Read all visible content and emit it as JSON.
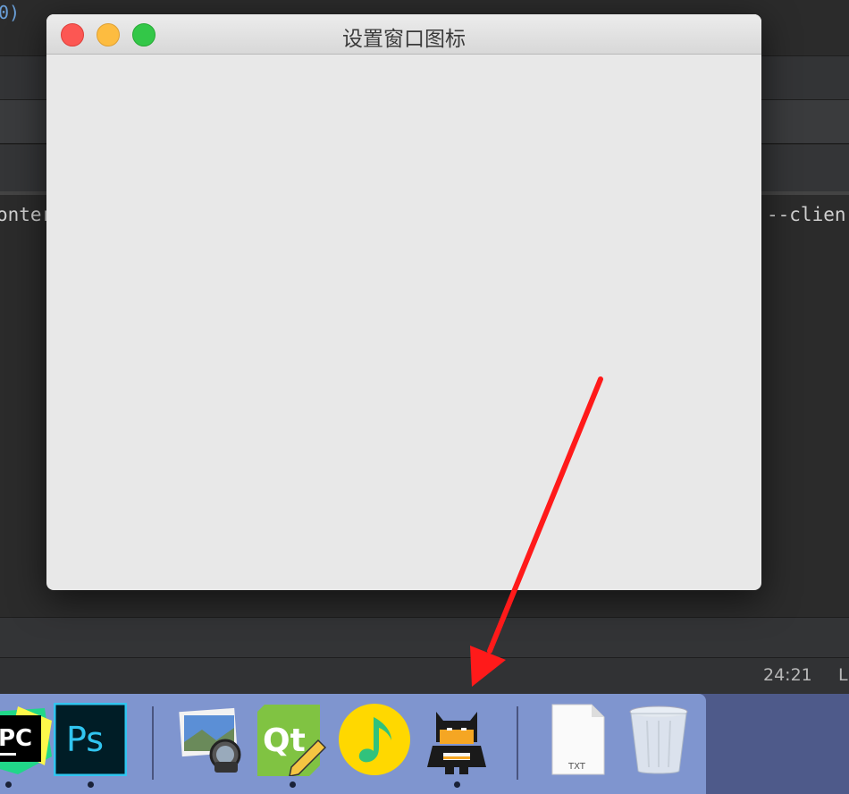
{
  "window": {
    "title": "设置窗口图标"
  },
  "ide": {
    "code_fragment": "0)",
    "terminal_left": "onter",
    "terminal_right": "--clien",
    "status_time": "24:21",
    "status_extra": "L"
  },
  "dock": {
    "file_icon_label": "TXT",
    "pycharm_label": "PC",
    "photoshop_label": "Ps",
    "qt_label": "Qt"
  },
  "colors": {
    "arrow": "#ff1a1a",
    "dock": "#7f95cf",
    "window_bg": "#e8e8e8"
  }
}
